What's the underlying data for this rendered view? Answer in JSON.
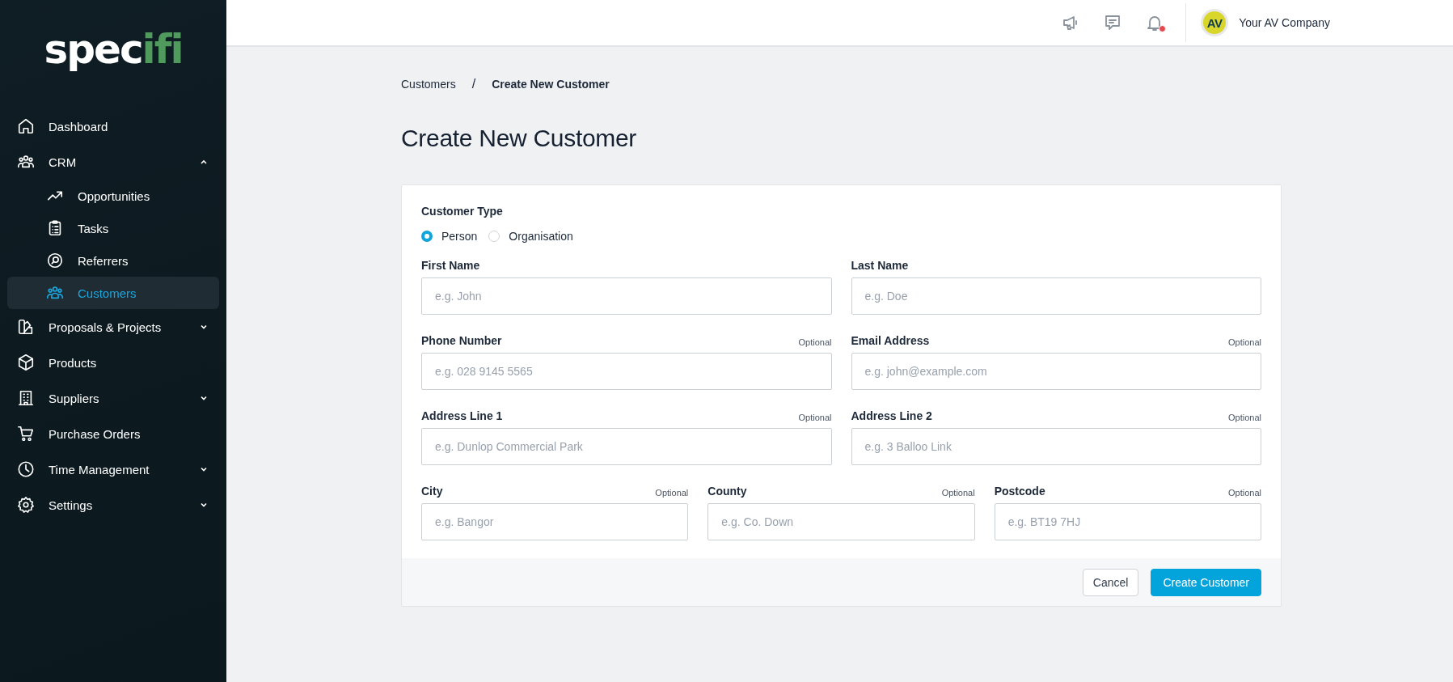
{
  "sidebar": {
    "logo": {
      "main": "spec",
      "accent": "ifi"
    },
    "items": [
      {
        "label": "Dashboard",
        "selected": false
      },
      {
        "label": "CRM",
        "selected": false,
        "expanded": true,
        "children": [
          {
            "label": "Opportunities",
            "selected": false
          },
          {
            "label": "Tasks",
            "selected": false
          },
          {
            "label": "Referrers",
            "selected": false
          },
          {
            "label": "Customers",
            "selected": true
          }
        ]
      },
      {
        "label": "Proposals & Projects",
        "selected": false,
        "expanded": false
      },
      {
        "label": "Products",
        "selected": false
      },
      {
        "label": "Suppliers",
        "selected": false,
        "expanded": false
      },
      {
        "label": "Purchase Orders",
        "selected": false
      },
      {
        "label": "Time Management",
        "selected": false,
        "expanded": false
      },
      {
        "label": "Settings",
        "selected": false,
        "expanded": false
      }
    ]
  },
  "topbar": {
    "notifications_unread": true,
    "account": {
      "initials": "AV",
      "name": "Your AV Company"
    }
  },
  "breadcrumb": [
    "Customers",
    "Create New Customer"
  ],
  "breadcrumb_separator": "/",
  "page_title": "Create New Customer",
  "form": {
    "customer_type": {
      "label": "Customer Type",
      "options": [
        {
          "label": "Person",
          "selected": true
        },
        {
          "label": "Organisation",
          "selected": false
        }
      ]
    },
    "rows": [
      [
        {
          "label": "First Name",
          "placeholder": "e.g. John"
        },
        {
          "label": "Last Name",
          "placeholder": "e.g. Doe"
        }
      ],
      [
        {
          "label": "Phone Number",
          "note": "Optional",
          "placeholder": "e.g. 028 9145 5565"
        },
        {
          "label": "Email Address",
          "note": "Optional",
          "placeholder": "e.g. john@example.com"
        }
      ],
      [
        {
          "label": "Address Line 1",
          "note": "Optional",
          "placeholder": "e.g. Dunlop Commercial Park"
        },
        {
          "label": "Address Line 2",
          "note": "Optional",
          "placeholder": "e.g. 3 Balloo Link"
        }
      ],
      [
        {
          "label": "City",
          "note": "Optional",
          "placeholder": "e.g. Bangor"
        },
        {
          "label": "County",
          "note": "Optional",
          "placeholder": "e.g. Co. Down"
        },
        {
          "label": "Postcode",
          "note": "Optional",
          "placeholder": "e.g. BT19 7HJ"
        }
      ]
    ],
    "buttons": [
      {
        "label": "Cancel",
        "kind": "secondary"
      },
      {
        "label": "Create Customer",
        "kind": "primary"
      }
    ]
  }
}
